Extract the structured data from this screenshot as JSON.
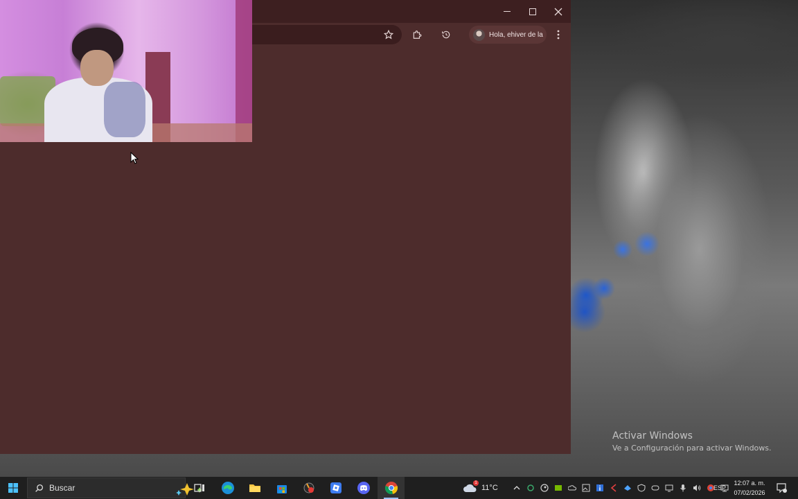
{
  "desktop": {
    "watermark": {
      "title": "Activar Windows",
      "subtitle": "Ve a Configuración para activar Windows."
    }
  },
  "browser": {
    "window_controls": {
      "minimize": "minimize-icon",
      "maximize": "maximize-icon",
      "close": "close-icon"
    },
    "toolbar": {
      "profile_label": "Hola, ehiver de la",
      "icons": [
        "star-icon",
        "extensions-icon",
        "history-icon",
        "more-menu-icon"
      ]
    },
    "background_color": "#4d2c2c"
  },
  "webcam_overlay": {
    "description_icon": "webcam-feed"
  },
  "taskbar": {
    "search_placeholder": "Buscar",
    "pinned_apps": [
      "task-view",
      "edge",
      "file-explorer",
      "microsoft-store",
      "unknown-app",
      "roblox-studio",
      "discord",
      "chrome"
    ],
    "active_app": "chrome",
    "weather": {
      "temperature": "11°C",
      "badge": "1"
    },
    "language": "ESP",
    "clock": {
      "time": "12:07 a. m.",
      "date": "07/02/2026"
    }
  }
}
